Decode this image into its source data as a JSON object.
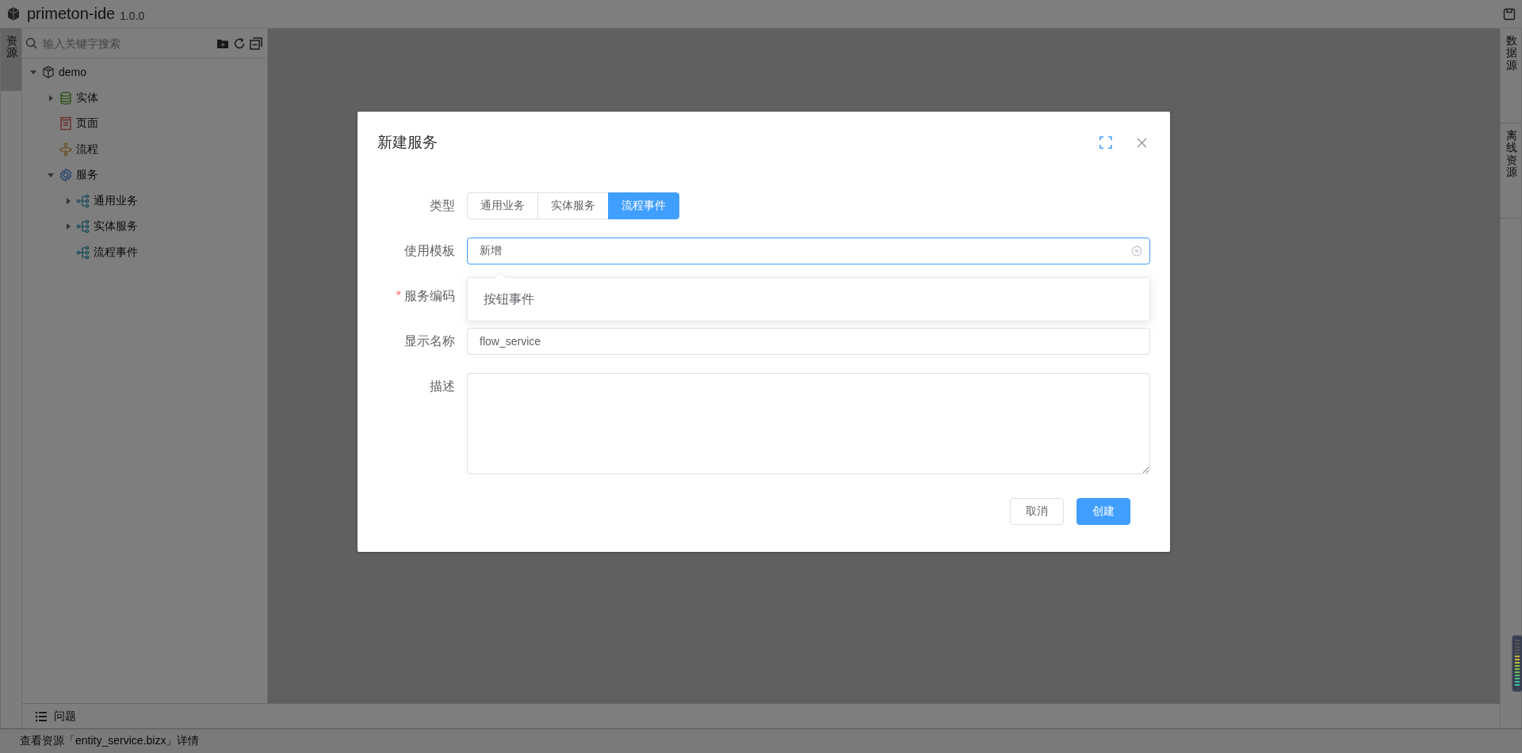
{
  "title_bar": {
    "app_name": "primeton-ide",
    "version": "1.0.0"
  },
  "left_tabs": [
    {
      "label": "资源",
      "selected": true
    }
  ],
  "explorer": {
    "search": {
      "placeholder": "输入关键字搜索"
    },
    "tree": [
      {
        "label": "demo",
        "kind": "package",
        "expanded": true,
        "children": [
          {
            "label": "实体",
            "kind": "database",
            "expanded": false
          },
          {
            "label": "页面",
            "kind": "page"
          },
          {
            "label": "流程",
            "kind": "flow"
          },
          {
            "label": "服务",
            "kind": "gear",
            "expanded": true,
            "children": [
              {
                "label": "通用业务",
                "kind": "service",
                "expanded": false
              },
              {
                "label": "实体服务",
                "kind": "service",
                "expanded": false
              },
              {
                "label": "流程事件",
                "kind": "service"
              }
            ]
          }
        ]
      }
    ]
  },
  "right_tabs": [
    {
      "label": "数据源",
      "selected": false
    },
    {
      "label": "离线资源",
      "selected": false
    }
  ],
  "bottom_panel": {
    "label": "问题"
  },
  "status_bar": {
    "text": "查看资源「entity_service.bizx」详情"
  },
  "dialog": {
    "title": "新建服务",
    "fields": [
      {
        "kind": "segmented",
        "label": "类型",
        "options": [
          {
            "label": "通用业务",
            "selected": false
          },
          {
            "label": "实体服务",
            "selected": false
          },
          {
            "label": "流程事件",
            "selected": true
          }
        ]
      },
      {
        "kind": "select",
        "label": "使用模板",
        "value": "新增",
        "focused": true
      },
      {
        "kind": "covered",
        "label": "服务编码",
        "required_mark": "*"
      },
      {
        "kind": "input",
        "label": "显示名称",
        "value": "flow_service"
      },
      {
        "kind": "textarea",
        "label": "描述"
      }
    ],
    "dropdown": {
      "options": [
        "按钮事件"
      ]
    },
    "buttons": [
      {
        "label": "取消",
        "kind": "default"
      },
      {
        "label": "创建",
        "kind": "primary"
      }
    ]
  }
}
